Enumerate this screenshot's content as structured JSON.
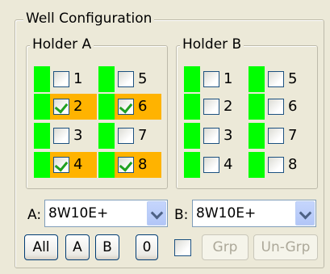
{
  "title": "Well Configuration",
  "holder_a": {
    "title": "Holder A",
    "wells": [
      {
        "num": "1",
        "checked": false
      },
      {
        "num": "5",
        "checked": false
      },
      {
        "num": "2",
        "checked": true
      },
      {
        "num": "6",
        "checked": true
      },
      {
        "num": "3",
        "checked": false
      },
      {
        "num": "7",
        "checked": false
      },
      {
        "num": "4",
        "checked": true
      },
      {
        "num": "8",
        "checked": true
      }
    ]
  },
  "holder_b": {
    "title": "Holder B",
    "wells": [
      {
        "num": "1",
        "checked": false
      },
      {
        "num": "5",
        "checked": false
      },
      {
        "num": "2",
        "checked": false
      },
      {
        "num": "6",
        "checked": false
      },
      {
        "num": "3",
        "checked": false
      },
      {
        "num": "7",
        "checked": false
      },
      {
        "num": "4",
        "checked": false
      },
      {
        "num": "8",
        "checked": false
      }
    ]
  },
  "combo_a": {
    "label": "A:",
    "value": "8W10E+"
  },
  "combo_b": {
    "label": "B:",
    "value": "8W10E+"
  },
  "buttons": {
    "all": "All",
    "a": "A",
    "b": "B",
    "zero": "0",
    "grp": "Grp",
    "ungrp": "Un-Grp"
  },
  "colors": {
    "led": "#00ff00",
    "highlight": "#ffb300",
    "check": "#21a121"
  }
}
